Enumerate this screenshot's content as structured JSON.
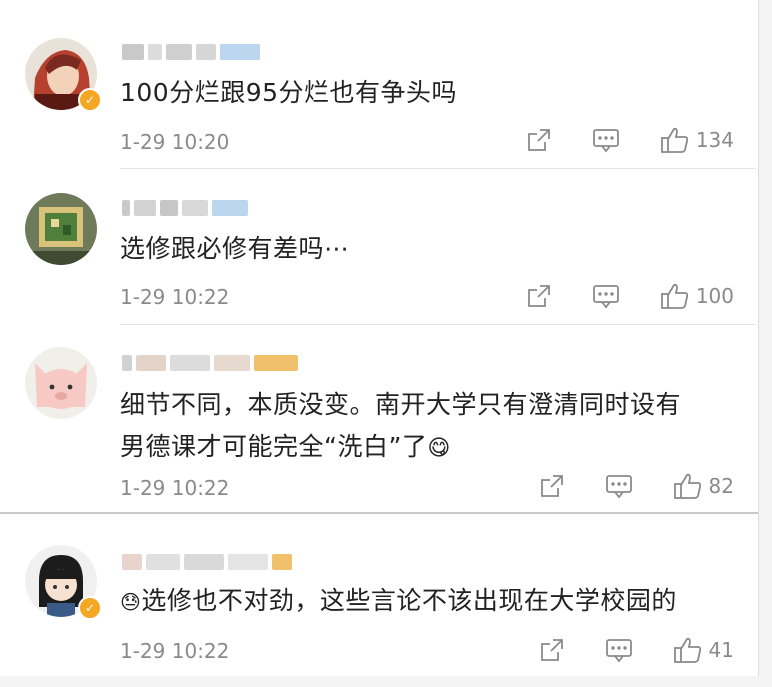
{
  "comments": [
    {
      "text": "100分烂跟95分烂也有争头吗",
      "time": "1-29 10:20",
      "likes": "134",
      "verified": true
    },
    {
      "text": "选修跟必修有差吗⋯",
      "time": "1-29 10:22",
      "likes": "100",
      "verified": false
    },
    {
      "text_line1": "细节不同，本质没变。南开大学只有澄清同时设有",
      "text_line2": "男德课才可能完全“洗白”了",
      "emoji": "😋",
      "time": "1-29 10:22",
      "likes": "82",
      "verified": false
    },
    {
      "emoji": "😓",
      "text": "选修也不对劲，这些言论不该出现在大学校园的",
      "time": "1-29 10:22",
      "likes": "41",
      "verified": true
    }
  ],
  "icons": {
    "share": "share-icon",
    "comment": "comment-icon",
    "like": "thumbs-up-icon"
  },
  "colors": {
    "text": "#222222",
    "meta": "#8a8a8a",
    "verified_badge": "#f5a623",
    "name_blur_blue": "#bcd6f0",
    "name_blur_gold": "#f0c06a"
  }
}
